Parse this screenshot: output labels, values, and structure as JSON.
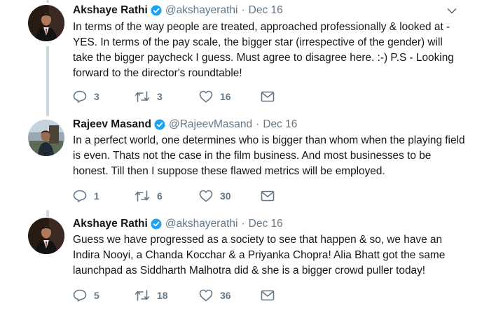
{
  "tweets": [
    {
      "name": "Akshaye Rathi",
      "handle": "@akshayerathi",
      "separator": "·",
      "date": "Dec 16",
      "text": "In terms of the way people are treated, approached professionally & looked at - YES. In terms of the pay scale, the bigger star (irrespective of the gender) will take the bigger paycheck I guess. Must agree to disagree here. :-) P.S - Looking forward to the director's roundtable!",
      "replies": "3",
      "retweets": "3",
      "likes": "16",
      "avatar_icon": "avatar-man-suit"
    },
    {
      "name": "Rajeev Masand",
      "handle": "@RajeevMasand",
      "separator": "·",
      "date": "Dec 16",
      "text": "In a perfect world, one determines who is bigger than whom when the playing field is even. Thats not the case in the film business. And most businesses to be honest. Till then I suppose these flawed metrics will be employed.",
      "replies": "1",
      "retweets": "6",
      "likes": "30",
      "avatar_icon": "avatar-man-outdoors"
    },
    {
      "name": "Akshaye Rathi",
      "handle": "@akshayerathi",
      "separator": "·",
      "date": "Dec 16",
      "text": "Guess we have progressed as a society to see that happen & so, we have an Indira Nooyi, a Chanda Kocchar & a Priyanka Chopra! Alia Bhatt got the same launchpad as Siddharth Malhotra did & she is a bigger crowd puller today!",
      "replies": "5",
      "retweets": "18",
      "likes": "36",
      "avatar_icon": "avatar-man-suit"
    }
  ],
  "colors": {
    "text": "#14171a",
    "secondary": "#657786",
    "verified": "#1da1f2",
    "thread_line": "#ccd6dd"
  }
}
